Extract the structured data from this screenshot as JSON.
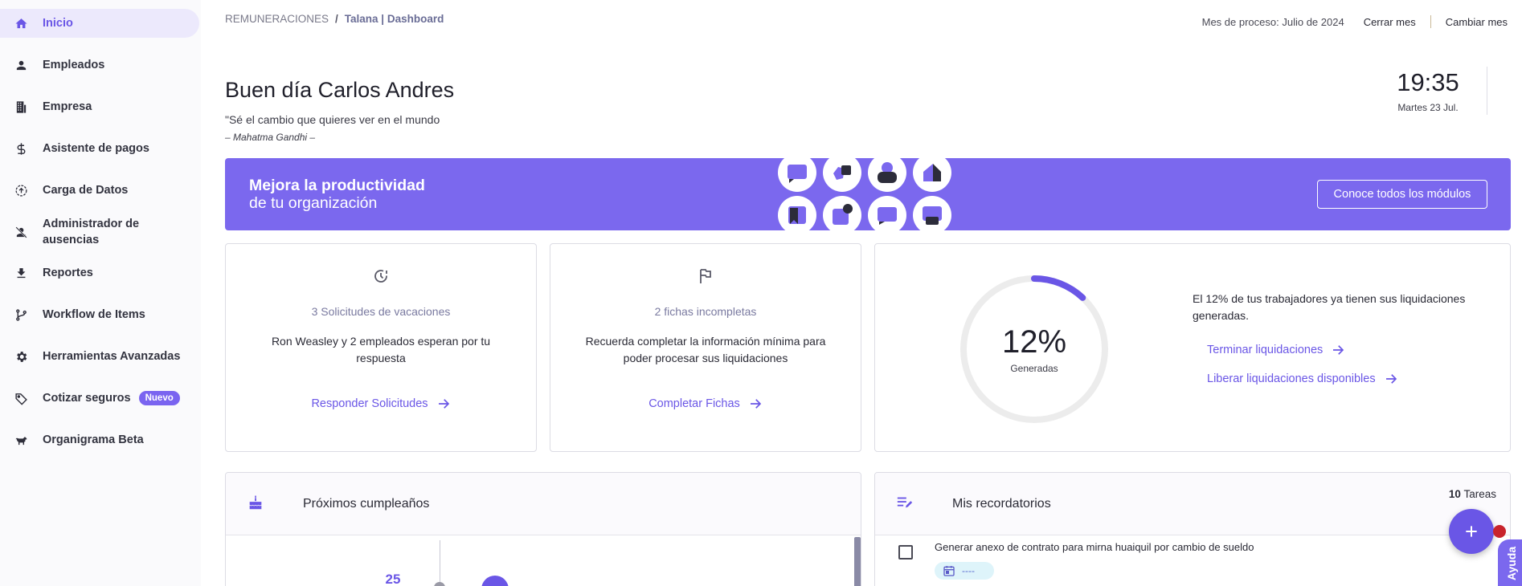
{
  "sidebar": {
    "items": [
      {
        "label": "Inicio",
        "icon": "home-icon"
      },
      {
        "label": "Empleados",
        "icon": "person-icon"
      },
      {
        "label": "Empresa",
        "icon": "building-icon"
      },
      {
        "label": "Asistente de pagos",
        "icon": "dollar-icon"
      },
      {
        "label": "Carga de Datos",
        "icon": "upload-icon"
      },
      {
        "label": "Administrador de ausencias",
        "label_line1": "Administrador de",
        "label_line2": "ausencias",
        "icon": "person-off-icon"
      },
      {
        "label": "Reportes",
        "icon": "download-icon"
      },
      {
        "label": "Workflow de Items",
        "icon": "branch-icon"
      },
      {
        "label": "Herramientas Avanzadas",
        "icon": "gear-icon"
      },
      {
        "label": "Cotizar seguros",
        "icon": "tag-icon",
        "badge": "Nuevo"
      },
      {
        "label": "Organigrama Beta",
        "icon": "dog-icon"
      }
    ]
  },
  "header": {
    "breadcrumb_root": "REMUNERACIONES",
    "breadcrumb_sep": "/",
    "breadcrumb_current": "Talana | Dashboard",
    "period": "Mes de proceso: Julio de 2024",
    "close_month": "Cerrar mes",
    "change_month": "Cambiar mes"
  },
  "greeting": {
    "title": "Buen día Carlos Andres",
    "quote": "\"Sé el cambio que quieres ver en el mundo",
    "author": "– Mahatma Gandhi –",
    "time": "19:35",
    "date": "Martes 23 Jul."
  },
  "banner": {
    "title": "Mejora la productividad",
    "subtitle": "de tu organización",
    "button": "Conoce todos los módulos"
  },
  "cards": {
    "vacations": {
      "title": "3 Solicitudes de vacaciones",
      "desc": "Ron Weasley y 2 empleados esperan por tu respuesta",
      "link": "Responder Solicitudes"
    },
    "files": {
      "title": "2 fichas incompletas",
      "desc": "Recuerda completar la información mínima para poder procesar sus liquidaciones",
      "link": "Completar Fichas"
    },
    "payroll": {
      "percent_value": 12,
      "percent_label": "12%",
      "caption": "Generadas",
      "text": "El 12% de tus trabajadores ya tienen sus liquidaciones generadas.",
      "link1": "Terminar liquidaciones",
      "link2": "Liberar liquidaciones disponibles"
    }
  },
  "birthdays": {
    "title": "Próximos cumpleaños",
    "day": "25"
  },
  "reminders": {
    "title": "Mis recordatorios",
    "count": "10",
    "count_label": "Tareas",
    "task_text": "Generar anexo de contrato para mirna huaiquil por cambio de sueldo",
    "task_date": "----"
  },
  "help": {
    "label": "Ayuda"
  },
  "colors": {
    "accent": "#6a56e6",
    "banner": "#7b68ee",
    "notification": "#c8232c"
  }
}
